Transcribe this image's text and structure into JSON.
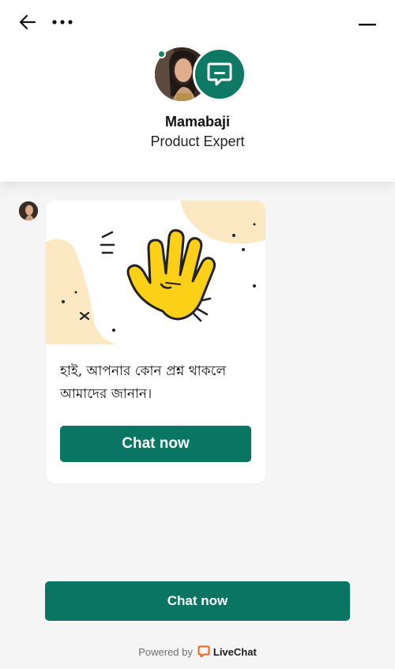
{
  "header": {
    "back_icon": "arrow-left-icon",
    "more_icon": "more-horizontal-icon",
    "minimize_icon": "minimize-icon",
    "agent": {
      "name": "Mamabaji",
      "role": "Product Expert",
      "status": "online"
    },
    "brand_icon": "chat-bubble-icon",
    "brand_color": "#0e7a66"
  },
  "message": {
    "illustration_icon": "waving-hand-icon",
    "text": "হাই, আপনার কোন প্রশ্ন থাকলে আমাদের জানান।",
    "button_label": "Chat now"
  },
  "footer": {
    "button_label": "Chat now",
    "powered_by": "Powered by",
    "brand_name": "LiveChat",
    "brand_color": "#f26322"
  },
  "colors": {
    "primary": "#0b7563",
    "background": "#f5f5f5"
  }
}
